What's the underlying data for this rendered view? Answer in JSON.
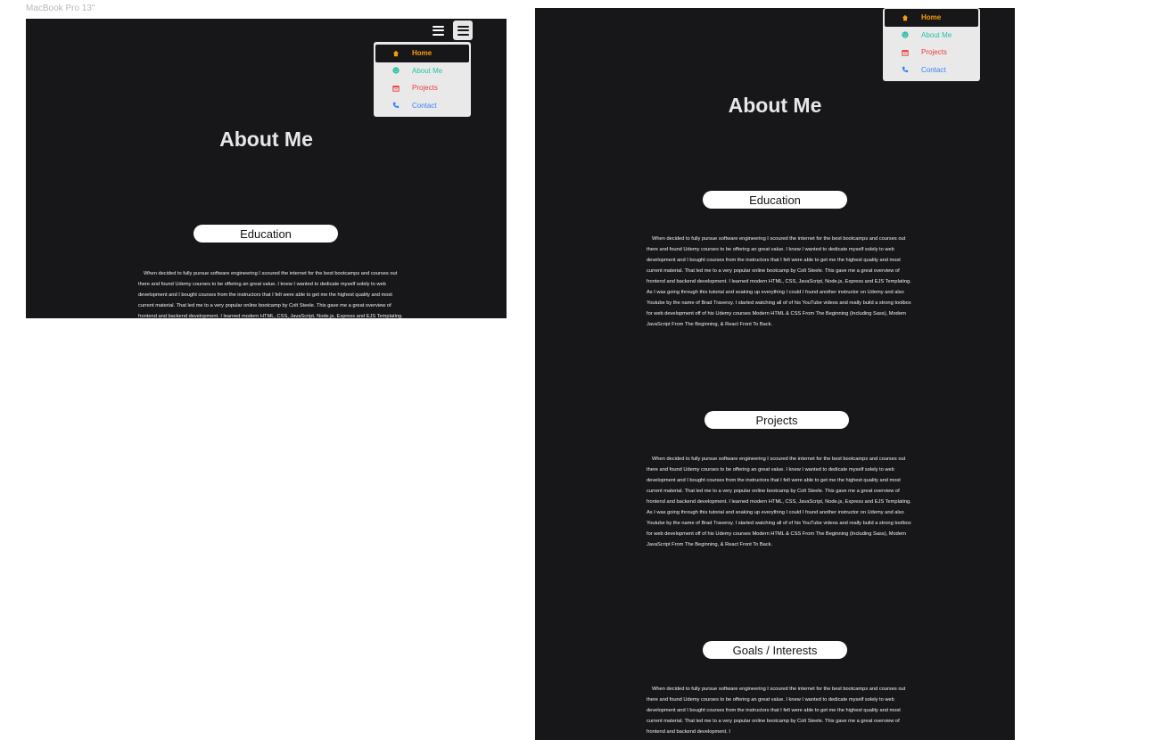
{
  "canvas": {
    "frame_label": "MacBook Pro 13\""
  },
  "page": {
    "title": "About Me"
  },
  "menu": {
    "items": [
      {
        "label": "Home",
        "icon": "home-icon",
        "color": "#f59e0b"
      },
      {
        "label": "About Me",
        "icon": "smile-icon",
        "color": "#25c1a6"
      },
      {
        "label": "Projects",
        "icon": "calendar-icon",
        "color": "#ec3d3d"
      },
      {
        "label": "Contact",
        "icon": "phone-icon",
        "color": "#3b82f6"
      }
    ]
  },
  "sections": [
    {
      "heading": "Education",
      "text": "When decided to fully pursue software engineering I scoured the internet for the best bootcamps and courses out there and found Udemy courses to be offering an great value. I knew I wanted to dedicate myself solely to web development and I bought courses from the instructors that I felt were able to get me the highest quality and most current material. That led me to a very popular online bootcamp by Colt Steele. This gave me a great overview of frontend and backend development. I learned modern HTML, CSS, JavaScript, Node.js, Express and EJS Templating. As I was going through this tutorial and soaking up everything I could I found another instructor on Udemy and also Youtube by the name of Brad Traversy. I started watching all of of his YouTube videos and really build a strong toolbox for web development off of his Udemy courses Modern HTML & CSS From The Beginning (Including Sass), Modern JavaScript From The Beginning, & React Front To Back."
    },
    {
      "heading": "Projects",
      "text": "When decided to fully pursue software engineering I scoured the internet for the best bootcamps and courses out there and found Udemy courses to be offering an great value. I knew I wanted to dedicate myself solely to web development and I bought courses from the instructors that I felt were able to get me the highest quality and most current material. That led me to a very popular online bootcamp by Colt Steele. This gave me a great overview of frontend and backend development. I learned modern HTML, CSS, JavaScript, Node.js, Express and EJS Templating. As I was going through this tutorial and soaking up everything I could I found another instructor on Udemy and also Youtube by the name of Brad Traversy. I started watching all of of his YouTube videos and really build a strong toolbox for web development off of his Udemy courses Modern HTML & CSS From The Beginning (Including Sass), Modern JavaScript From The Beginning, & React Front To Back."
    },
    {
      "heading": "Goals / Interests",
      "text": "When decided to fully pursue software engineering I scoured the internet for the best bootcamps and courses out there and found Udemy courses to be offering an great value. I knew I wanted to dedicate myself solely to web development and I bought courses from the instructors that I felt were able to get me the highest quality and most current material. That led me to a very popular online bootcamp by Colt Steele. This gave me a great overview of frontend and backend development. I"
    }
  ],
  "colors": {
    "background": "#17171a",
    "pill": "#ffffff",
    "menu_bg": "#e9e9ea"
  }
}
